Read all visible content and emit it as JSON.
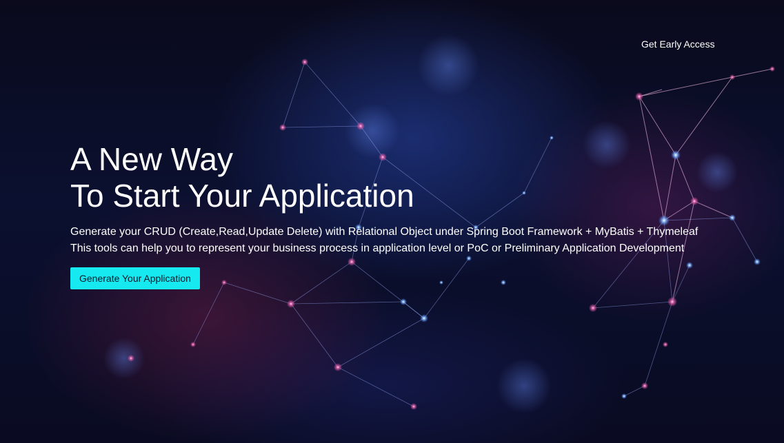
{
  "nav": {
    "early_access_label": "Get Early Access"
  },
  "hero": {
    "headline_line1": "A New Way",
    "headline_line2": "To Start Your Application",
    "description_line1": "Generate your CRUD (Create,Read,Update Delete) with Relational Object under Spring Boot Framework + MyBatis + Thymeleaf",
    "description_line2": "This tools can help you to represent your business process in application level or PoC or Preliminary Application Development",
    "cta_label": "Generate Your Application"
  },
  "colors": {
    "cta_background": "#17e9f0",
    "text": "#ffffff",
    "background": "#0b1030"
  }
}
